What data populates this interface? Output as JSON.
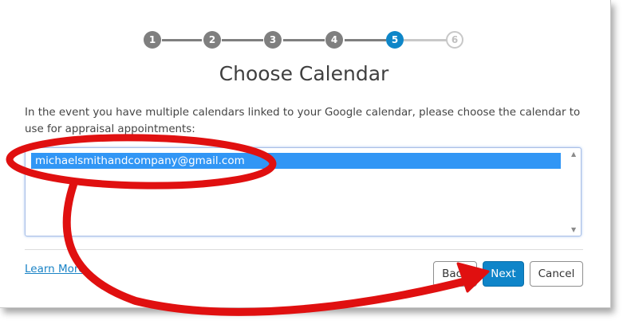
{
  "stepper": {
    "steps": [
      "1",
      "2",
      "3",
      "4",
      "5",
      "6"
    ],
    "current": 5,
    "colors": {
      "done": "#7f7f7f",
      "active": "#0e86c8",
      "todo": "#c8c8c8"
    }
  },
  "heading": "Choose Calendar",
  "description": "In the event you have multiple calendars linked to your Google calendar, please choose the calendar to use for appraisal appointments:",
  "calendar_list": {
    "options": [
      "michaelsmithandcompany@gmail.com"
    ],
    "selected": "michaelsmithandcompany@gmail.com"
  },
  "footer": {
    "learn_more": "Learn More",
    "back_label": "Back",
    "next_label": "Next",
    "cancel_label": "Cancel"
  },
  "annotation": {
    "color": "#e01010",
    "icons": [
      "red-ellipse-highlight",
      "red-arrow"
    ]
  }
}
